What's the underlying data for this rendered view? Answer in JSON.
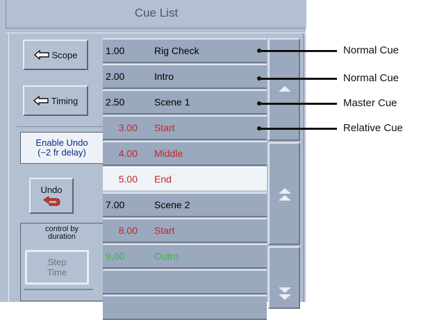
{
  "window": {
    "title": "Cue List"
  },
  "sidebar": {
    "scope_label": "Scope",
    "timing_label": "Timing",
    "enable_undo_line1": "Enable Undo",
    "enable_undo_line2": "(~2 fr delay)",
    "undo_label": "Undo",
    "control_label_line1": "control by",
    "control_label_line2": "duration",
    "step_time_line1": "Step",
    "step_time_line2": "Time"
  },
  "cues": [
    {
      "number": "1.00",
      "name": "Rig Check",
      "kind": "normal",
      "color": "#111111"
    },
    {
      "number": "2.00",
      "name": "Intro",
      "kind": "normal",
      "color": "#111111"
    },
    {
      "number": "2.50",
      "name": "Scene 1",
      "kind": "normal",
      "color": "#111111"
    },
    {
      "number": "3.00",
      "name": "Start",
      "kind": "relative",
      "color": "#c4262b"
    },
    {
      "number": "4.00",
      "name": "Middle",
      "kind": "relative",
      "color": "#c4262b"
    },
    {
      "number": "5.00",
      "name": "End",
      "kind": "relative",
      "color": "#c4262b",
      "selected": true
    },
    {
      "number": "7.00",
      "name": "Scene 2",
      "kind": "normal",
      "color": "#111111"
    },
    {
      "number": "8.00",
      "name": "Start",
      "kind": "relative",
      "color": "#c4262b"
    },
    {
      "number": "9.00",
      "name": "Outro",
      "kind": "normal",
      "color": "#39b54a"
    },
    {
      "number": "",
      "name": "",
      "kind": "empty",
      "color": "#111111"
    }
  ],
  "callouts": [
    "Normal Cue",
    "Normal Cue",
    "Master Cue",
    "Relative Cue"
  ],
  "colors": {
    "panel": "#b3c0d1",
    "row": "#9aa9bd",
    "selected_row": "#eef3f8",
    "relative_cue_text": "#c4262b",
    "green_cue_text": "#39b54a",
    "undo_arrow": "#d9342b"
  },
  "icons": {
    "scope": "arrow-left-icon",
    "timing": "arrow-left-icon",
    "undo": "undo-arrow-icon",
    "scroll_up": "scroll-up-icon",
    "scroll_page_up": "scroll-page-up-icon",
    "scroll_page_down": "scroll-page-down-icon"
  }
}
